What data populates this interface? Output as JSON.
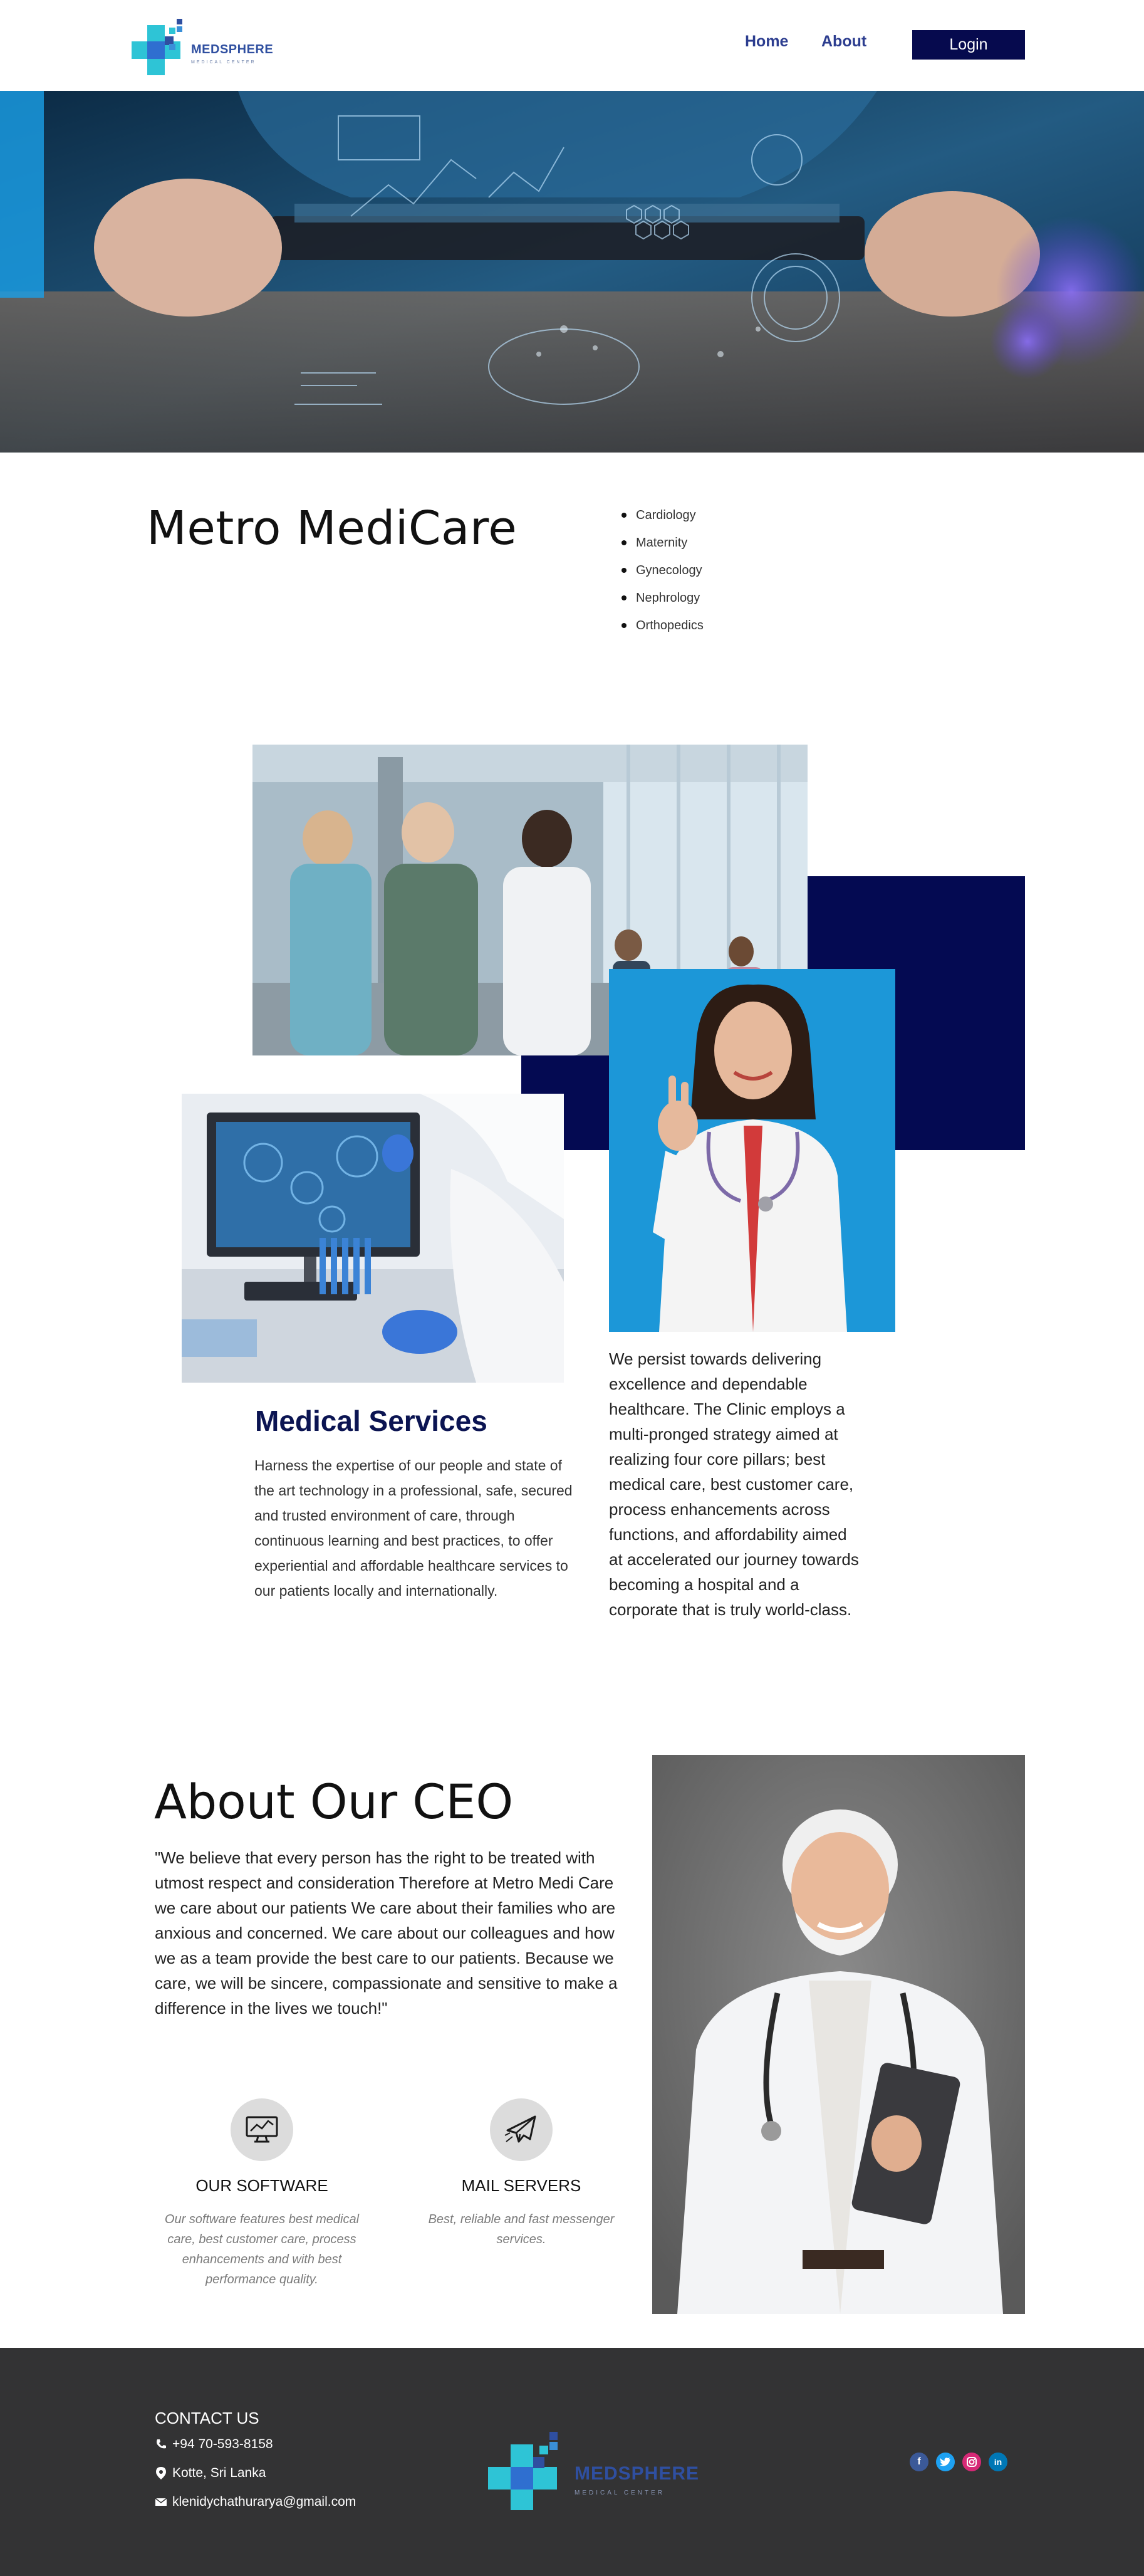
{
  "header": {
    "brand_name": "MEDSPHERE",
    "brand_tagline": "MEDICAL CENTER",
    "nav": [
      {
        "label": "Home"
      },
      {
        "label": "About"
      }
    ],
    "login_label": "Login"
  },
  "intro": {
    "title": "Metro MediCare",
    "departments": [
      "Cardiology",
      "Maternity",
      "Gynecology",
      "Nephrology",
      "Orthopedics"
    ]
  },
  "services": {
    "heading": "Medical Services",
    "text": "Harness the expertise of our people and state of the art technology in a professional, safe, secured and trusted environment of care, through continuous learning and best practices, to offer experiential and affordable healthcare services to our patients locally and internationally.",
    "pillars_text": "We persist towards delivering excellence and dependable healthcare. The Clinic employs a multi-pronged strategy aimed at realizing four core pillars; best medical care, best customer care, process enhancements across functions, and affordability aimed at accelerated our journey towards becoming a hospital and a corporate that is truly world-class."
  },
  "ceo": {
    "title": "About Our CEO",
    "quote": "\"We believe that every person has the right to be treated with utmost respect and consideration Therefore at Metro Medi Care we care about our patients We care about their families who are anxious and concerned. We care about our colleagues and how we as a team provide the best care to our patients. Because we care, we will be sincere, compassionate and sensitive to make a difference in the lives we touch!\""
  },
  "features": [
    {
      "icon": "monitor-chart-icon",
      "title": "OUR SOFTWARE",
      "desc": "Our software features best medical care, best customer care, process enhancements and with best performance quality."
    },
    {
      "icon": "paper-plane-icon",
      "title": "MAIL SERVERS",
      "desc": "Best, reliable and fast messenger services."
    }
  ],
  "footer": {
    "contact_heading": "CONTACT US",
    "phone": "+94 70-593-8158",
    "address": "Kotte, Sri Lanka",
    "email": "klenidychathurarya@gmail.com",
    "brand_name": "MEDSPHERE",
    "brand_tagline": "MEDICAL CENTER",
    "social": [
      {
        "icon": "facebook-icon",
        "color": "#3b5998"
      },
      {
        "icon": "twitter-icon",
        "color": "#1da1f2"
      },
      {
        "icon": "instagram-icon",
        "color": "#d62976"
      },
      {
        "icon": "linkedin-icon",
        "color": "#0077b5"
      }
    ]
  },
  "colors": {
    "navy": "#060a4e",
    "nav_link": "#2c3d8f",
    "footer_bg": "#333334",
    "logo_teal": "#2ec4d6",
    "logo_blue": "#2f4fa0"
  }
}
